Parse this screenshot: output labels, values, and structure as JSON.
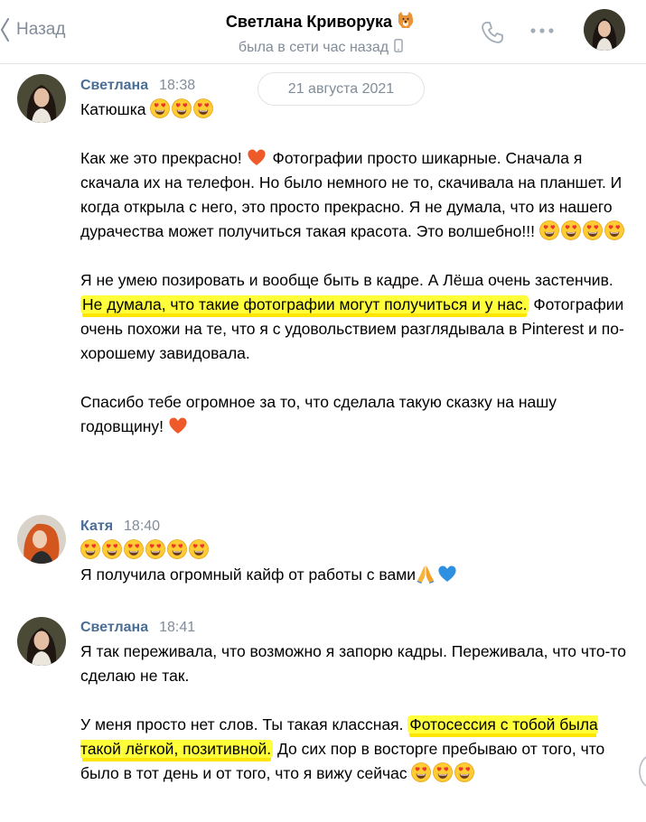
{
  "header": {
    "back_label": "Назад",
    "title": "Светлана Криворука",
    "title_emoji": "dog-icon",
    "status": "была в сети час назад",
    "status_icon": "phone-device-icon"
  },
  "date_divider": "21 августа 2021",
  "messages": [
    {
      "author": "Светлана",
      "time": "18:38",
      "avatar": "dark-haired-woman",
      "p1_text": "Катюшка",
      "p2_a": "Как же это прекрасно!",
      "p2_b": "Фотографии просто шикарные. Сначала я скачала их на телефон. Но было немного не то, скачивала на планшет. И когда открыла с него, это просто прекрасно. Я не думала, что из нашего дурачества может получиться такая красота. Это волшебно!!!",
      "p3_a": "Я не умею позировать и вообще быть в кадре. А Лёша очень застенчив.",
      "p3_hl": "Не думала, что такие фотографии могут получиться и у нас.",
      "p3_b": "Фотографии очень похожи на те, что я с удовольствием разглядывала в Pinterest и по-хорошему завидовала.",
      "p4_a": "Спасибо тебе огромное за то, что сделала такую сказку на нашу годовщину!"
    },
    {
      "author": "Катя",
      "time": "18:40",
      "avatar": "red-haired-woman",
      "p2_a": "Я получила огромный кайф от работы с вами"
    },
    {
      "author": "Светлана",
      "time": "18:41",
      "avatar": "dark-haired-woman",
      "p1_a": "Я так переживала, что возможно я запорю кадры. Переживала, что что-то сделаю не так.",
      "p2_a": "У меня просто нет слов. Ты такая классная.",
      "p2_hl": "Фотосессия с тобой была такой лёгкой, позитивной.",
      "p2_b": "До сих пор в восторге пребываю от того, что было в тот день и от того, что я вижу сейчас"
    }
  ],
  "colors": {
    "author": "#4a6e95",
    "muted": "#818c99",
    "highlight": "#ffff3a",
    "heart": "#e8502f",
    "blue_heart": "#2f8fe0"
  },
  "icons": [
    "back-chevron-icon",
    "phone-call-icon",
    "more-dots-icon",
    "heart-eyes-emoji",
    "orange-heart-emoji",
    "praying-hands-emoji",
    "blue-heart-emoji"
  ]
}
